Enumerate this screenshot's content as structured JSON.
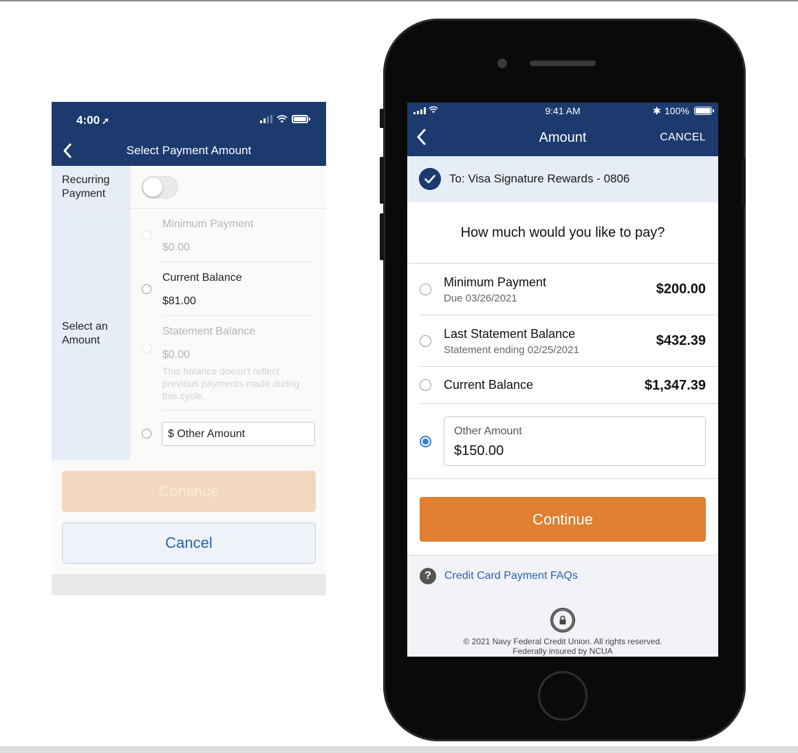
{
  "left_screen": {
    "status": {
      "time": "4:00",
      "location_glyph": "➚"
    },
    "nav": {
      "title": "Select Payment Amount"
    },
    "recurring": {
      "label": "Recurring Payment",
      "toggle_on": false
    },
    "select_label": "Select an Amount",
    "options": [
      {
        "title": "Minimum Payment",
        "amount": "$0.00",
        "enabled": false
      },
      {
        "title": "Current Balance",
        "amount": "$81.00",
        "enabled": true
      },
      {
        "title": "Statement Balance",
        "amount": "$0.00",
        "note": "This balance doesn't reflect previous payments made during this cycle.",
        "enabled": false
      }
    ],
    "other_amount": {
      "value": "$ Other Amount"
    },
    "buttons": {
      "continue": "Continue",
      "cancel": "Cancel"
    },
    "colors": {
      "header": "#1c3a6e",
      "continue_disabled": "#f2d8bf",
      "cancel_text": "#2a62b0"
    }
  },
  "right_screen": {
    "status": {
      "time": "9:41 AM",
      "bluetooth": "✱",
      "battery": "100%"
    },
    "nav": {
      "title": "Amount",
      "cancel": "CANCEL"
    },
    "to": "To: Visa Signature Rewards - 0806",
    "question": "How much would you like to pay?",
    "options": [
      {
        "title": "Minimum Payment",
        "sub": "Due 03/26/2021",
        "amount": "$200.00",
        "selected": false
      },
      {
        "title": "Last Statement Balance",
        "sub": "Statement ending 02/25/2021",
        "amount": "$432.39",
        "selected": false
      },
      {
        "title": "Current Balance",
        "sub": "",
        "amount": "$1,347.39",
        "selected": false
      }
    ],
    "other_amount": {
      "label": "Other Amount",
      "value": "$150.00",
      "selected": true
    },
    "continue": "Continue",
    "faq_icon": "?",
    "faq": "Credit Card Payment FAQs",
    "copyright_line1": "© 2021 Navy Federal Credit Union. All rights reserved.",
    "copyright_line2": "Federally insured by NCUA",
    "colors": {
      "header": "#1c3a6e",
      "continue": "#e07f30",
      "link": "#2a62b0",
      "radio_selected": "#3b7dd8"
    },
    "icons": [
      "chevron-left-icon",
      "checkmark-icon",
      "question-icon",
      "lock-icon"
    ]
  }
}
